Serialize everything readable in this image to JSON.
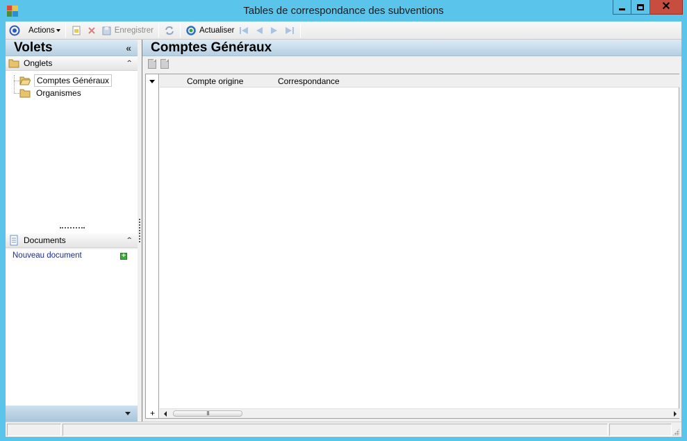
{
  "window": {
    "title": "Tables de correspondance des subventions",
    "controls": {
      "minimize": "minimize-icon",
      "maximize": "maximize-icon",
      "close": "close-icon"
    }
  },
  "toolbar": {
    "actions_label": "Actions",
    "save_label": "Enregistrer",
    "refresh_label": "Actualiser",
    "icons": [
      "circle-target-icon",
      "new-document-icon",
      "delete-icon",
      "save-icon",
      "sync-icon",
      "refresh-icon",
      "first-record-icon",
      "previous-record-icon",
      "next-record-icon",
      "last-record-icon"
    ]
  },
  "left_pane": {
    "title": "Volets",
    "collapse_glyph": "«",
    "groups": {
      "onglets": {
        "label": "Onglets",
        "items": [
          {
            "label": "Comptes Généraux",
            "selected": true
          },
          {
            "label": "Organismes",
            "selected": false
          }
        ]
      },
      "documents": {
        "label": "Documents",
        "new_document_label": "Nouveau document"
      }
    }
  },
  "main": {
    "title": "Comptes Généraux",
    "grid": {
      "columns": [
        "Compte origine",
        "Correspondance"
      ],
      "rows": [],
      "add_row_glyph": "+",
      "scroll_thumb_glyph": "III"
    }
  },
  "colors": {
    "titlebar": "#5bc4ea",
    "close_button": "#c74e3e",
    "header_gradient_top": "#dcebf6",
    "header_gradient_bottom": "#b6cfe2",
    "link": "#1c2a9a"
  }
}
